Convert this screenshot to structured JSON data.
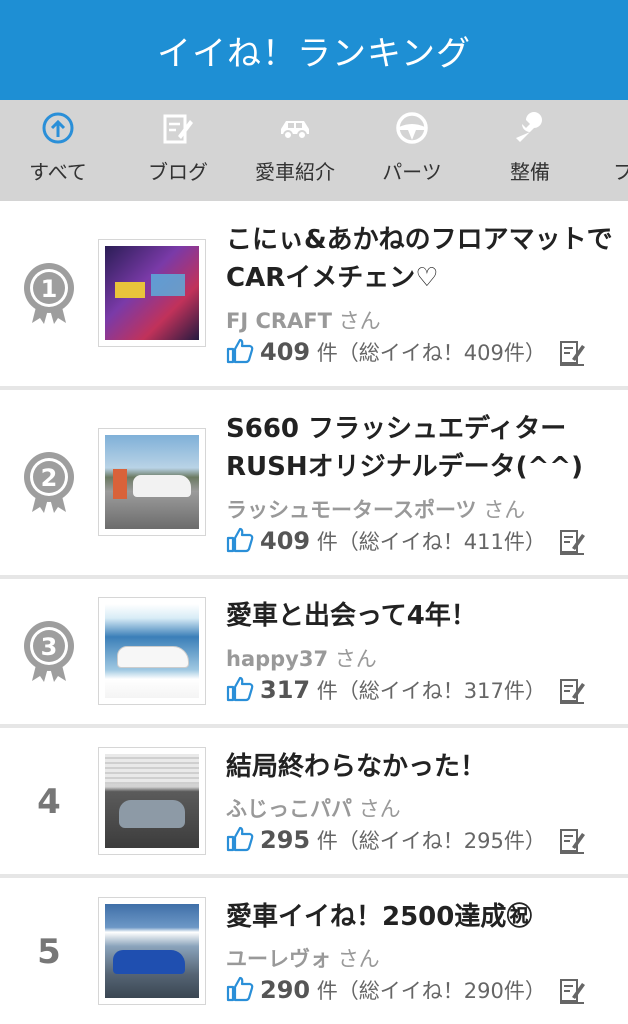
{
  "header": {
    "title": "イイね！ランキング"
  },
  "tabs": [
    {
      "label": "すべて",
      "icon": "upload-circle-icon"
    },
    {
      "label": "ブログ",
      "icon": "blog-edit-icon"
    },
    {
      "label": "愛車紹介",
      "icon": "car-icon"
    },
    {
      "label": "パーツ",
      "icon": "steering-wheel-icon"
    },
    {
      "label": "整備",
      "icon": "wrench-icon"
    },
    {
      "label": "フ",
      "icon": ""
    }
  ],
  "items": [
    {
      "rank": "1",
      "title": "こにぃ&あかねのフロアマットでCARイメチェン♡",
      "user": "FJ CRAFT",
      "san": "さん",
      "count": "409",
      "unit": "件",
      "total": "（総イイね！409件）"
    },
    {
      "rank": "2",
      "title": "S660 フラッシュエディターRUSHオリジナルデータ(^^)",
      "user": "ラッシュモータースポーツ",
      "san": "さん",
      "count": "409",
      "unit": "件",
      "total": "（総イイね！411件）"
    },
    {
      "rank": "3",
      "title": "愛車と出会って4年！",
      "user": "happy37",
      "san": "さん",
      "count": "317",
      "unit": "件",
      "total": "（総イイね！317件）"
    },
    {
      "rank": "4",
      "title": "結局終わらなかった！",
      "user": "ふじっこパパ",
      "san": "さん",
      "count": "295",
      "unit": "件",
      "total": "（総イイね！295件）"
    },
    {
      "rank": "5",
      "title": "愛車イイね！2500達成㊗",
      "user": "ユーレヴォ",
      "san": "さん",
      "count": "290",
      "unit": "件",
      "total": "（総イイね！290件）"
    }
  ],
  "colors": {
    "header": "#1e8fd4",
    "tab_bar": "#d4d4d4",
    "medal": "#9e9e9e",
    "like_icon": "#2a8fd8",
    "active_tab_icon": "#2a8fd8"
  }
}
